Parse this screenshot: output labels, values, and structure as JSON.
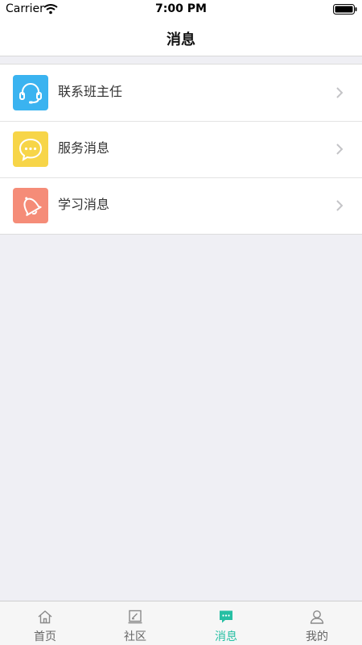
{
  "status_bar": {
    "carrier": "Carrier",
    "time": "7:00 PM"
  },
  "nav": {
    "title": "消息"
  },
  "list": [
    {
      "label": "联系班主任",
      "icon": "headset-icon",
      "color": "#3ab3f0"
    },
    {
      "label": "服务消息",
      "icon": "chat-bubble-icon",
      "color": "#f7d548"
    },
    {
      "label": "学习消息",
      "icon": "bell-icon",
      "color": "#f58c78"
    }
  ],
  "tabs": [
    {
      "label": "首页",
      "icon": "home-icon",
      "active": false
    },
    {
      "label": "社区",
      "icon": "community-icon",
      "active": false
    },
    {
      "label": "消息",
      "icon": "message-icon",
      "active": true
    },
    {
      "label": "我的",
      "icon": "profile-icon",
      "active": false
    }
  ],
  "colors": {
    "accent": "#26bfa3",
    "background": "#efeff4"
  }
}
